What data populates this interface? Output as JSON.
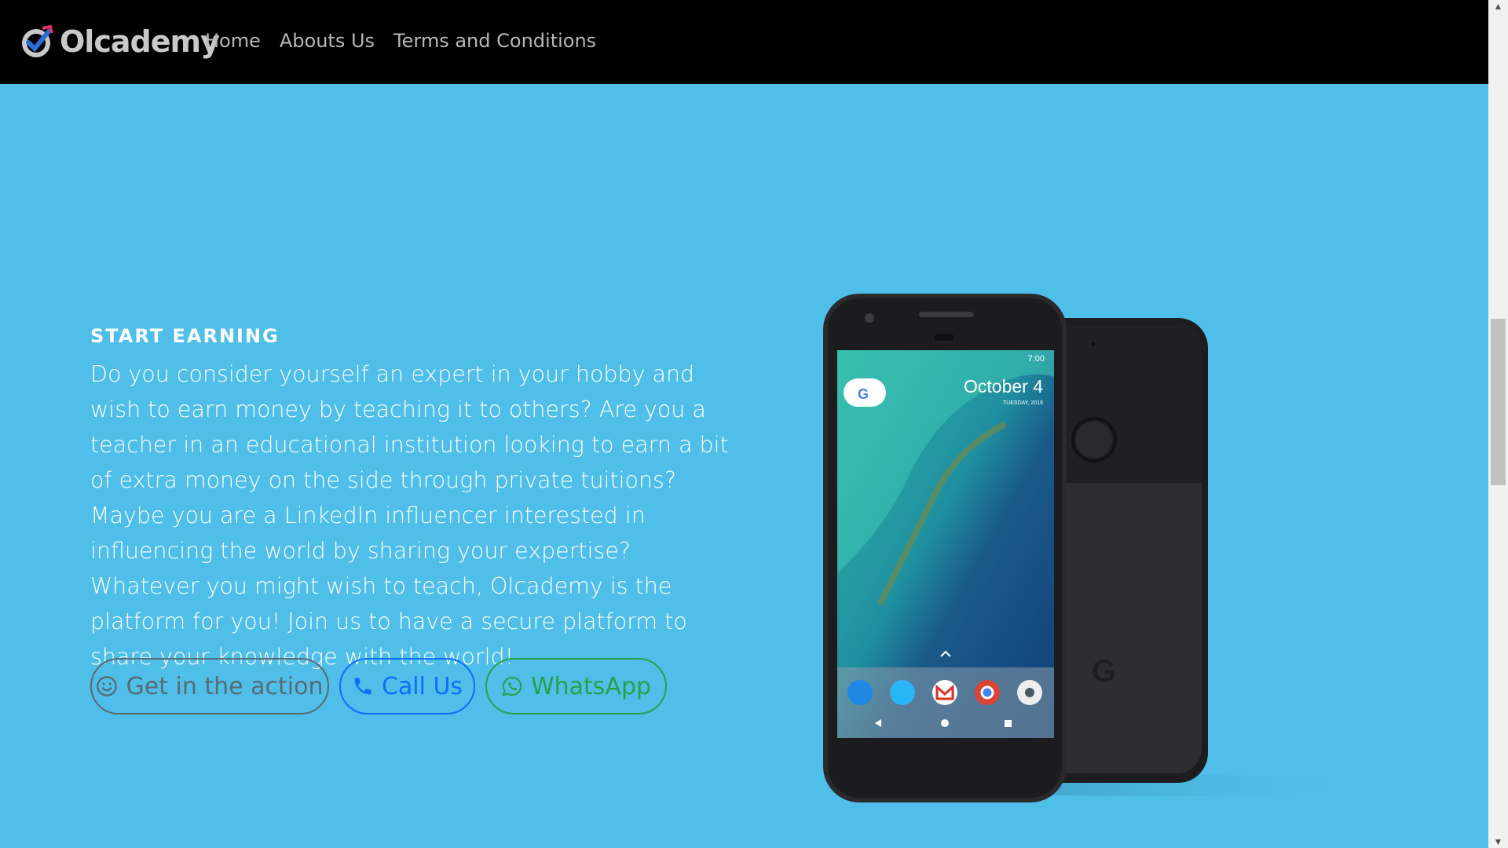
{
  "header": {
    "brand_name": "Olcademy",
    "brand_icon": "olcademy-logo-icon",
    "nav": [
      {
        "label": "Home"
      },
      {
        "label": "Abouts Us"
      },
      {
        "label": "Terms and Conditions"
      }
    ]
  },
  "hero": {
    "eyebrow": "START EARNING",
    "body": "Do you consider yourself an expert in your hobby and wish to earn money by teaching it to others? Are you a teacher in an educational institution looking to earn a bit of extra money on the side through private tuitions? Maybe you are a LinkedIn influencer interested in influencing the world by sharing your expertise? Whatever you might wish to teach, Olcademy is the platform for you! Join us to have a secure platform to share your knowledge with the world!",
    "buttons": {
      "action": {
        "label": "Get in the action",
        "icon": "smiley-icon"
      },
      "call": {
        "label": "Call Us",
        "icon": "phone-icon"
      },
      "whatsapp": {
        "label": "WhatsApp",
        "icon": "whatsapp-icon"
      }
    }
  },
  "phone_image": {
    "date": "October 4",
    "day": "TUESDAY, 2016",
    "time": "7:00"
  },
  "colors": {
    "page_bg": "#4fbfea",
    "header_bg": "#000000",
    "call_blue": "#0d6efd",
    "whatsapp_green": "#2aa046"
  }
}
